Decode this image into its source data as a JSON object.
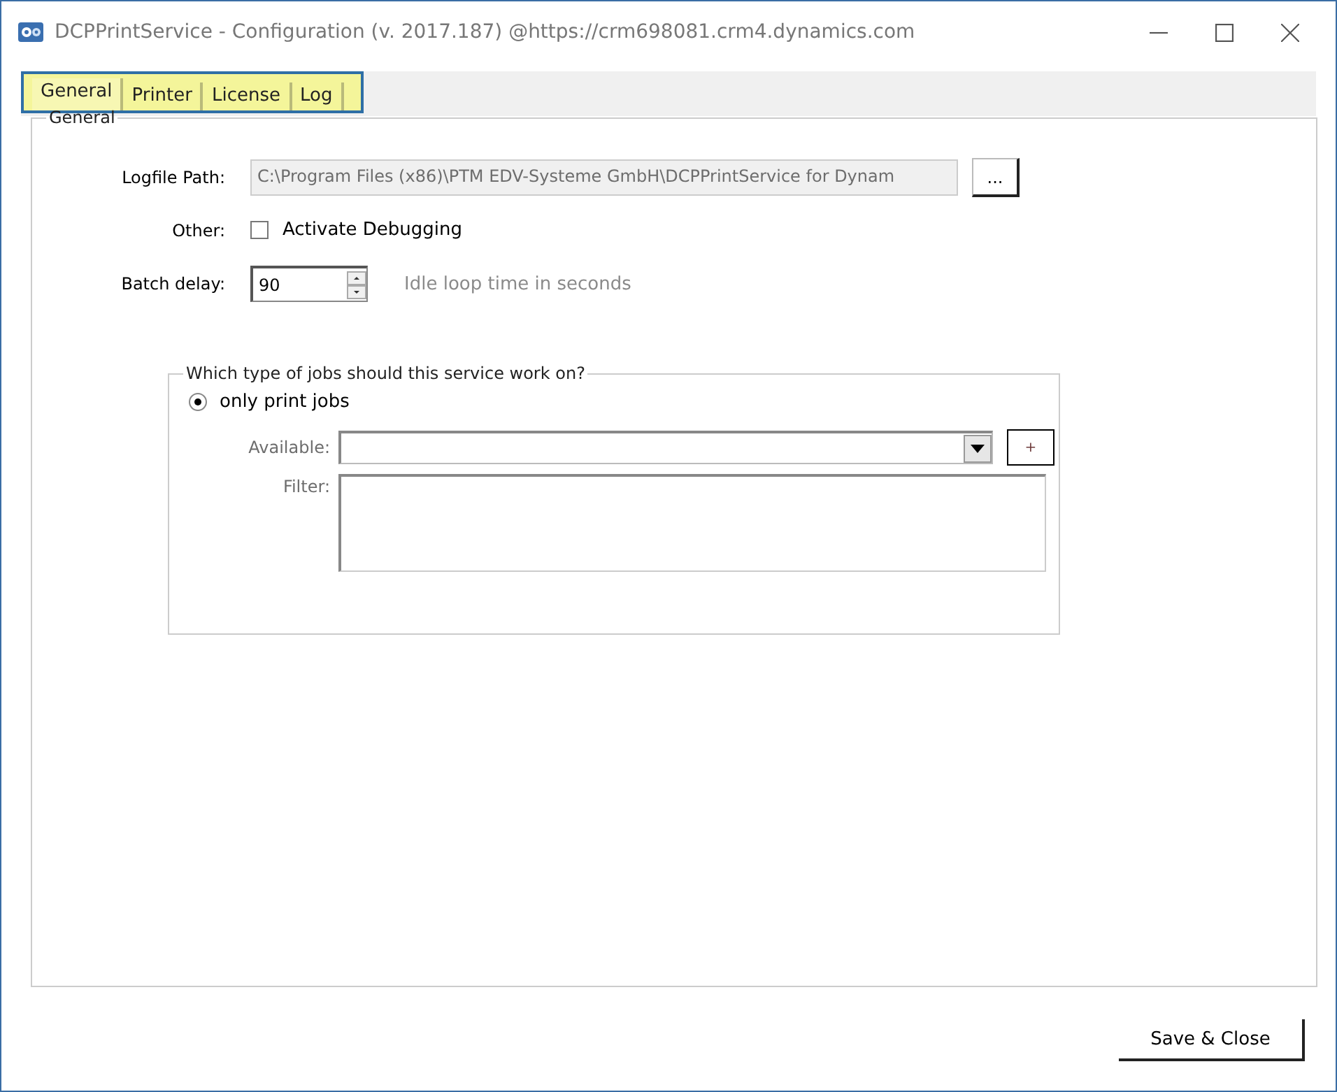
{
  "window": {
    "title": "DCPPrintService - Configuration  (v. 2017.187) @https://crm698081.crm4.dynamics.com"
  },
  "tabs_highlighted": true,
  "tabs": [
    {
      "label": "General",
      "selected": true
    },
    {
      "label": "Printer",
      "selected": false
    },
    {
      "label": "License",
      "selected": false
    },
    {
      "label": "Log",
      "selected": false
    }
  ],
  "general": {
    "title": "General",
    "logfile": {
      "label": "Logfile Path:",
      "value": "C:\\Program Files (x86)\\PTM EDV-Systeme GmbH\\DCPPrintService for Dynam",
      "disabled": true,
      "browse": "..."
    },
    "other": {
      "label": "Other:",
      "checkbox": "Activate Debugging",
      "checked": false
    },
    "batch": {
      "label": "Batch delay:",
      "value": "90",
      "hint": "Idle loop time in seconds"
    },
    "jobs": {
      "title": "Which type of jobs should this service work on?",
      "options": [
        {
          "label": "only print jobs",
          "selected": true
        }
      ],
      "available": {
        "label": "Available:",
        "add": "+"
      },
      "filter": {
        "label": "Filter:"
      }
    }
  },
  "buttons": [
    "Save & Close"
  ]
}
